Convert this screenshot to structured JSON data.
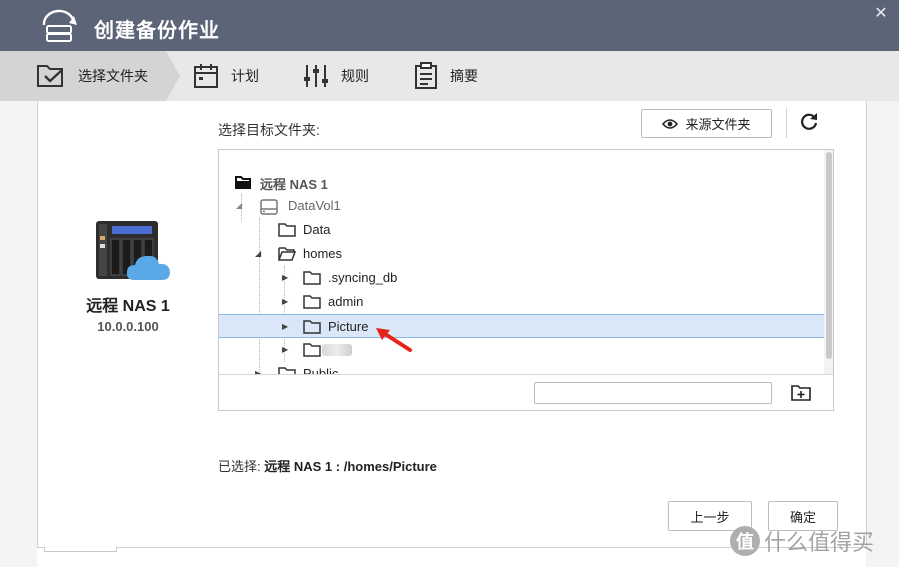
{
  "window": {
    "title": "创建备份作业",
    "close_glyph": "✕"
  },
  "steps": [
    {
      "label": "选择文件夹",
      "icon": "folder-check-icon",
      "active": true
    },
    {
      "label": "计划",
      "icon": "calendar-icon"
    },
    {
      "label": "规则",
      "icon": "sliders-icon"
    },
    {
      "label": "摘要",
      "icon": "clipboard-icon"
    }
  ],
  "nas": {
    "name": "远程 NAS 1",
    "ip": "10.0.0.100",
    "icon": "nas-cloud-icon"
  },
  "target": {
    "label": "选择目标文件夹:",
    "source_button": "来源文件夹",
    "tree": [
      {
        "label": "远程 NAS 1",
        "depth": 0,
        "icon": "folder-filled-icon",
        "expander": "",
        "style": "root"
      },
      {
        "label": "DataVol1",
        "depth": 1,
        "icon": "drive-icon",
        "expander": "◢",
        "style": "muted"
      },
      {
        "label": "Data",
        "depth": 2,
        "icon": "folder-icon",
        "expander": "",
        "style": "normal"
      },
      {
        "label": "homes",
        "depth": 2,
        "icon": "folder-open-icon",
        "expander": "◢",
        "style": "normal"
      },
      {
        "label": ".syncing_db",
        "depth": 3,
        "icon": "folder-icon",
        "expander": "▶",
        "style": "normal"
      },
      {
        "label": "admin",
        "depth": 3,
        "icon": "folder-icon",
        "expander": "▶",
        "style": "normal"
      },
      {
        "label": "Picture",
        "depth": 3,
        "icon": "folder-icon",
        "expander": "▶",
        "style": "normal",
        "selected": true
      },
      {
        "label": "",
        "depth": 3,
        "icon": "folder-icon",
        "expander": "▶",
        "style": "normal",
        "blurred": true
      },
      {
        "label": "Public",
        "depth": 2,
        "icon": "folder-icon",
        "expander": "▶",
        "style": "normal"
      }
    ],
    "new_folder_value": ""
  },
  "selection": {
    "prefix": "已选择:",
    "path": "远程 NAS 1 : /homes/Picture"
  },
  "buttons": {
    "prev": "上一步",
    "ok": "确定"
  },
  "watermark": {
    "logo": "值",
    "text": "什么值得买"
  },
  "colors": {
    "titlebar": "#5c6478",
    "selection": "#d9e7f8",
    "accent_arrow": "#e8231a"
  }
}
